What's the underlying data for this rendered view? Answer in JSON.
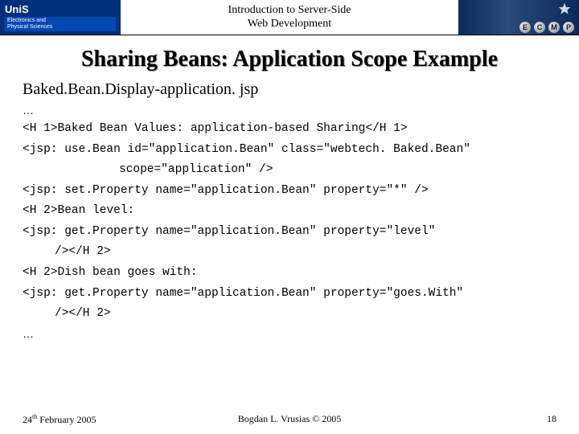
{
  "header": {
    "uni": "UniS",
    "dept_line1": "Electronics and",
    "dept_line2": "Physical Sciences",
    "title_line1": "Introduction to Server-Side",
    "title_line2": "Web Development",
    "badges": [
      "E",
      "C",
      "M",
      "P"
    ]
  },
  "slide": {
    "title": "Sharing Beans: Application Scope Example",
    "filename": "Baked.Bean.Display-application. jsp",
    "ellipsis1": "…",
    "code1": "<H 1>Baked Bean Values: application-based Sharing</H 1>",
    "code2": "<jsp: use.Bean id=\"application.Bean\" class=\"webtech. Baked.Bean\"",
    "code2b": "scope=\"application\" />",
    "code3": "<jsp: set.Property name=\"application.Bean\" property=\"*\" />",
    "code4": "<H 2>Bean level:",
    "code5": "<jsp: get.Property name=\"application.Bean\" property=\"level\"",
    "code5b": "/></H 2>",
    "code6": "<H 2>Dish bean goes with:",
    "code7": "<jsp: get.Property name=\"application.Bean\" property=\"goes.With\"",
    "code7b": "/></H 2>",
    "ellipsis2": "…"
  },
  "footer": {
    "date_day": "24",
    "date_sup": "th",
    "date_rest": " February 2005",
    "center": "Bogdan L. Vrusias © 2005",
    "page": "18"
  }
}
